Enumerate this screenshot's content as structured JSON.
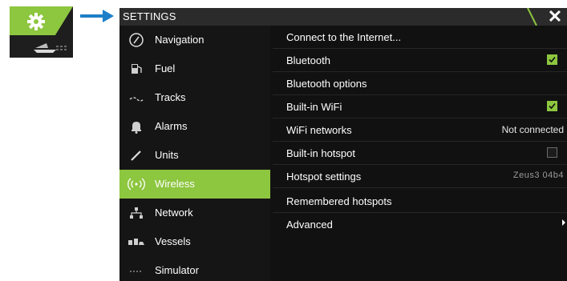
{
  "window": {
    "title": "SETTINGS",
    "close_glyph": "✕"
  },
  "colors": {
    "accent": "#8dc63f",
    "background": "#111111",
    "titlebar": "#2b2b2b"
  },
  "sidebar": {
    "items": [
      {
        "label": "Navigation",
        "icon": "compass-icon",
        "selected": false
      },
      {
        "label": "Fuel",
        "icon": "fuel-icon",
        "selected": false
      },
      {
        "label": "Tracks",
        "icon": "tracks-icon",
        "selected": false
      },
      {
        "label": "Alarms",
        "icon": "bell-icon",
        "selected": false
      },
      {
        "label": "Units",
        "icon": "ruler-icon",
        "selected": false
      },
      {
        "label": "Wireless",
        "icon": "wireless-icon",
        "selected": true
      },
      {
        "label": "Network",
        "icon": "network-icon",
        "selected": false
      },
      {
        "label": "Vessels",
        "icon": "vessels-icon",
        "selected": false
      },
      {
        "label": "Simulator",
        "icon": "simulator-icon",
        "selected": false
      }
    ]
  },
  "content": {
    "rows": [
      {
        "label": "Connect to the Internet..."
      },
      {
        "label": "Bluetooth",
        "checked": true
      },
      {
        "label": "Bluetooth options"
      },
      {
        "label": "Built-in WiFi",
        "checked": true
      },
      {
        "label": "WiFi networks",
        "value": "Not connected"
      },
      {
        "label": "Built-in hotspot",
        "checked": false
      },
      {
        "label": "Hotspot settings",
        "value": "Zeus3 04b4"
      },
      {
        "label": "Remembered hotspots"
      },
      {
        "label": "Advanced",
        "submenu": true
      }
    ]
  }
}
